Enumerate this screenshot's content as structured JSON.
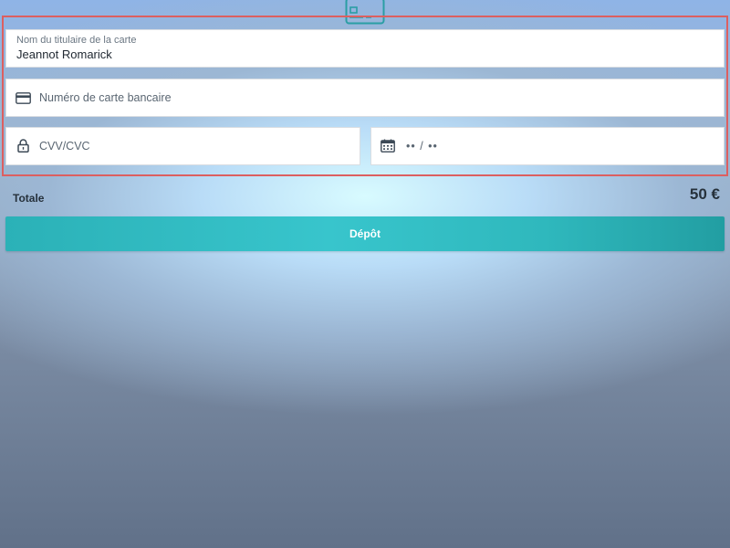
{
  "form": {
    "cardholder": {
      "label": "Nom du titulaire de la carte",
      "value": "Jeannot Romarick"
    },
    "card_number": {
      "placeholder": "Numéro de carte bancaire",
      "icon": "credit-card-icon"
    },
    "cvv": {
      "placeholder": "CVV/CVC",
      "icon": "lock-icon"
    },
    "expiry": {
      "placeholder": "•• / ••",
      "icon": "calendar-icon"
    }
  },
  "summary": {
    "total_label": "Totale",
    "total_amount": "50 €"
  },
  "submit": {
    "label": "Dépôt"
  },
  "colors": {
    "accent": "#2fb8bd",
    "highlight_border": "#dc5f60",
    "icon": "#3d4a57"
  }
}
